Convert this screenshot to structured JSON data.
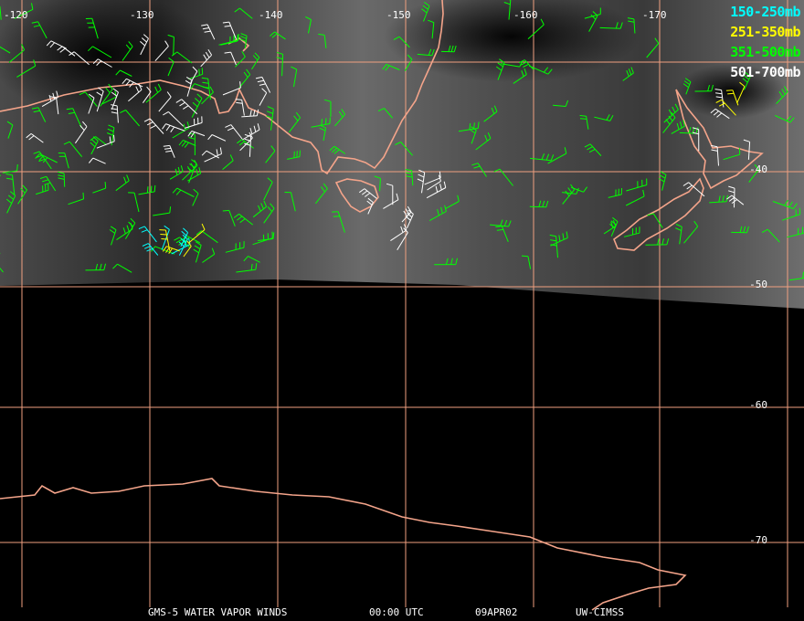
{
  "map": {
    "lon_labels": [
      "-120",
      "-130",
      "-140",
      "-150",
      "-160",
      "-170"
    ],
    "lat_labels": [
      "-40",
      "-50",
      "-60",
      "-70"
    ],
    "colors": {
      "grid": "#f0a080",
      "coast": "#f4a48a",
      "background": "#000000"
    }
  },
  "legend": [
    {
      "label": "150-250mb",
      "color": "#00ffff"
    },
    {
      "label": "251-350mb",
      "color": "#ffff00"
    },
    {
      "label": "351-500mb",
      "color": "#00ff00"
    },
    {
      "label": "501-700mb",
      "color": "#ffffff"
    }
  ],
  "footer": {
    "satellite": "GMS-5 WATER VAPOR WINDS",
    "time": "00:00 UTC",
    "date": "09APR02",
    "credit": "UW-CIMSS"
  }
}
